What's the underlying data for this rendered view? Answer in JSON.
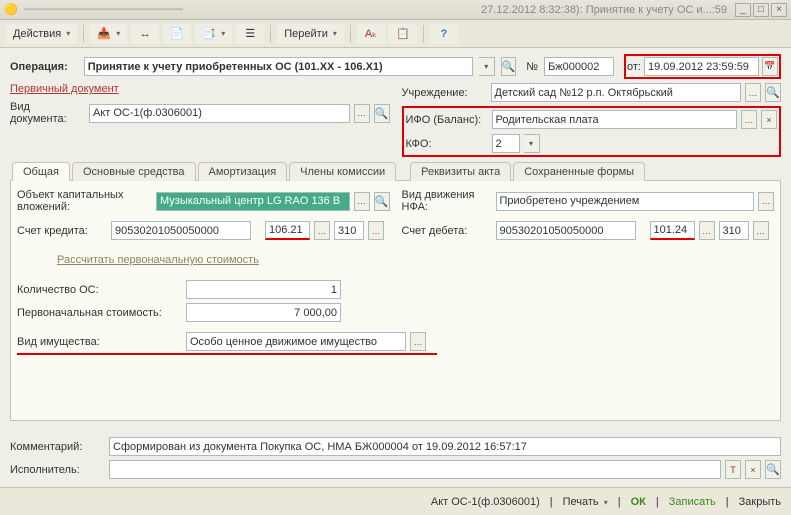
{
  "titlebar": {
    "text": "27.12.2012 8:32:38): Принятие к учету ОС и...:59"
  },
  "toolbar": {
    "actions": "Действия",
    "goto": "Перейти"
  },
  "operation": {
    "label": "Операция:",
    "value": "Принятие к учету приобретенных ОС (101.XX - 106.X1)",
    "num_label": "№",
    "num_value": "Бж000002",
    "from_label": "от:",
    "date_value": "19.09.2012 23:59:59"
  },
  "primary_doc_label": "Первичный документ",
  "doc_type": {
    "label": "Вид документа:",
    "value": "Акт ОС-1(ф.0306001)"
  },
  "org": {
    "label": "Учреждение:",
    "value": "Детский сад №12 р.п. Октябрьский"
  },
  "ifo": {
    "label": "ИФО (Баланс):",
    "value": "Родительская плата"
  },
  "kfo": {
    "label": "КФО:",
    "value": "2"
  },
  "tabs": {
    "t1": "Общая",
    "t2": "Основные средства",
    "t3": "Амортизация",
    "t4": "Члены комиссии",
    "t5": "Реквизиты акта",
    "t6": "Сохраненные формы"
  },
  "obj": {
    "label": "Объект капитальных вложений:",
    "value": "Музыкальный центр LG  RAO 136 B"
  },
  "movement": {
    "label": "Вид движения НФА:",
    "value": "Приобретено учреждением"
  },
  "credit": {
    "label": "Счет кредита:",
    "acc": "90530201050050000",
    "code": "106.21",
    "ext": "310"
  },
  "debit": {
    "label": "Счет дебета:",
    "acc": "90530201050050000",
    "code": "101.24",
    "ext": "310"
  },
  "calc_link": "Рассчитать первоначальную стоимость",
  "qty": {
    "label": "Количество ОС:",
    "value": "1"
  },
  "cost": {
    "label": "Первоначальная стоимость:",
    "value": "7 000,00"
  },
  "prop_type": {
    "label": "Вид имущества:",
    "value": "Особо ценное движимое имущество"
  },
  "comment": {
    "label": "Комментарий:",
    "value": "Сформирован из документа Покупка ОС, НМА БЖ000004 от 19.09.2012 16:57:17"
  },
  "executor": {
    "label": "Исполнитель:"
  },
  "statusbar": {
    "doc": "Акт ОС-1(ф.0306001)",
    "print": "Печать",
    "ok": "ОК",
    "save": "Записать",
    "close": "Закрыть"
  }
}
